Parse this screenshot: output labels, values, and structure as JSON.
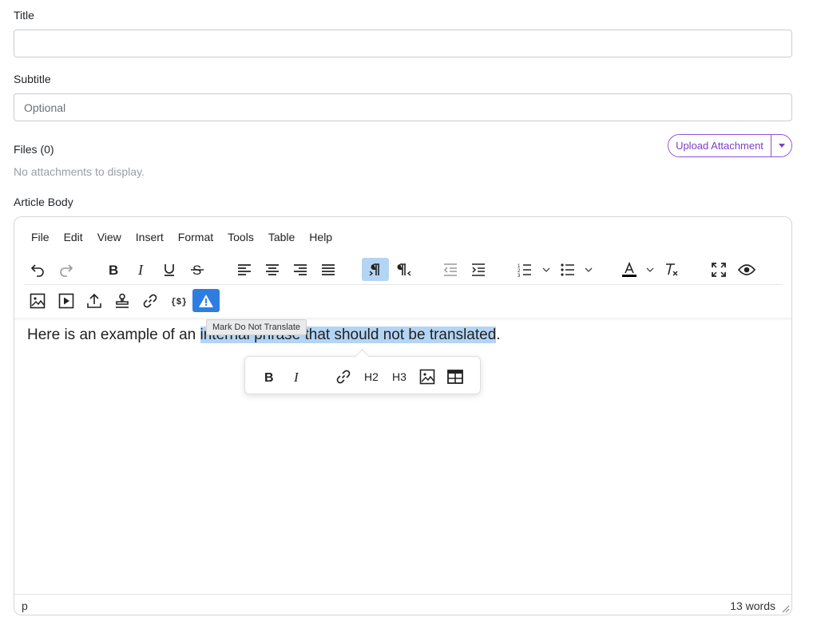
{
  "form": {
    "title_label": "Title",
    "title_value": "",
    "subtitle_label": "Subtitle",
    "subtitle_placeholder": "Optional",
    "files_label": "Files (0)",
    "no_attachments": "No attachments to display.",
    "upload_label": "Upload Attachment",
    "body_label": "Article Body"
  },
  "menubar": [
    "File",
    "Edit",
    "View",
    "Insert",
    "Format",
    "Tools",
    "Table",
    "Help"
  ],
  "toolbar_icons": [
    "undo-icon",
    "redo-icon",
    "bold-icon",
    "italic-icon",
    "underline-icon",
    "strikethrough-icon",
    "align-left-icon",
    "align-center-icon",
    "align-right-icon",
    "align-justify-icon",
    "ltr-icon",
    "rtl-icon",
    "outdent-icon",
    "indent-icon",
    "numbered-list-icon",
    "bullet-list-icon",
    "text-color-icon",
    "clear-formatting-icon",
    "fullscreen-icon",
    "preview-icon",
    "image-icon",
    "media-icon",
    "upload-icon",
    "stamp-icon",
    "link-icon",
    "code-variable-icon",
    "warning-icon"
  ],
  "editor": {
    "text_before": "Here is an example of an ",
    "text_selected": "internal phrase that should not be translated",
    "text_after": ".",
    "tooltip": "Mark Do Not Translate",
    "quickbar": {
      "h2": "H2",
      "h3": "H3"
    },
    "status_path": "p",
    "word_count": "13 words"
  },
  "colors": {
    "accent": "#7b3fc8",
    "selection": "#b4d4f4",
    "active_button": "#2f7de1"
  }
}
